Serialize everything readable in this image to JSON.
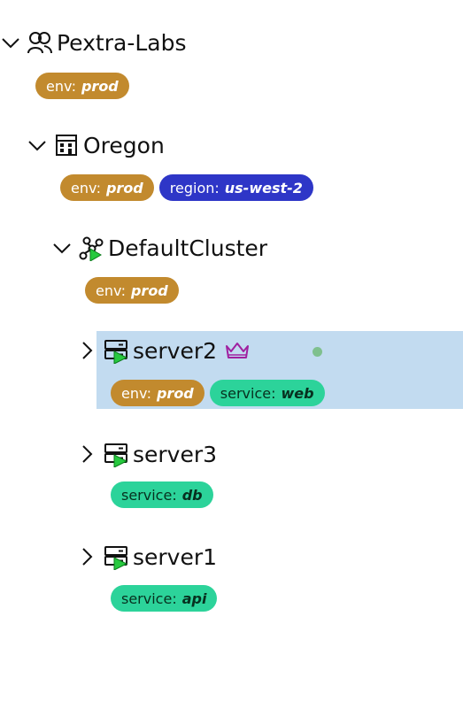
{
  "tree": {
    "org": {
      "label": "Pextra-Labs",
      "tags": [
        {
          "key": "env:",
          "value": "prod"
        }
      ]
    },
    "region": {
      "label": "Oregon",
      "tags": [
        {
          "key": "env:",
          "value": "prod"
        },
        {
          "key": "region:",
          "value": "us-west-2"
        }
      ]
    },
    "cluster": {
      "label": "DefaultCluster",
      "tags": [
        {
          "key": "env:",
          "value": "prod"
        }
      ]
    },
    "servers": [
      {
        "label": "server2",
        "tags": [
          {
            "key": "env:",
            "value": "prod"
          },
          {
            "key": "service:",
            "value": "web"
          }
        ],
        "selected": true,
        "leader": true,
        "status_color": "#7fc08e"
      },
      {
        "label": "server3",
        "tags": [
          {
            "key": "service:",
            "value": "db"
          }
        ]
      },
      {
        "label": "server1",
        "tags": [
          {
            "key": "service:",
            "value": "api"
          }
        ]
      }
    ]
  },
  "colors": {
    "env_tag": "#c28a2e",
    "region_tag": "#2e36c7",
    "service_tag": "#2cd39a",
    "selected_row": "#c2dbf0",
    "running_badge": "#27c93f",
    "crown": "#a020a0"
  },
  "icons": {
    "org": "users-icon",
    "region": "building-icon",
    "cluster": "cluster-icon",
    "server": "server-icon",
    "running": "play-icon",
    "leader": "crown-icon",
    "expanded": "chevron-down-icon",
    "collapsed": "chevron-right-icon"
  }
}
